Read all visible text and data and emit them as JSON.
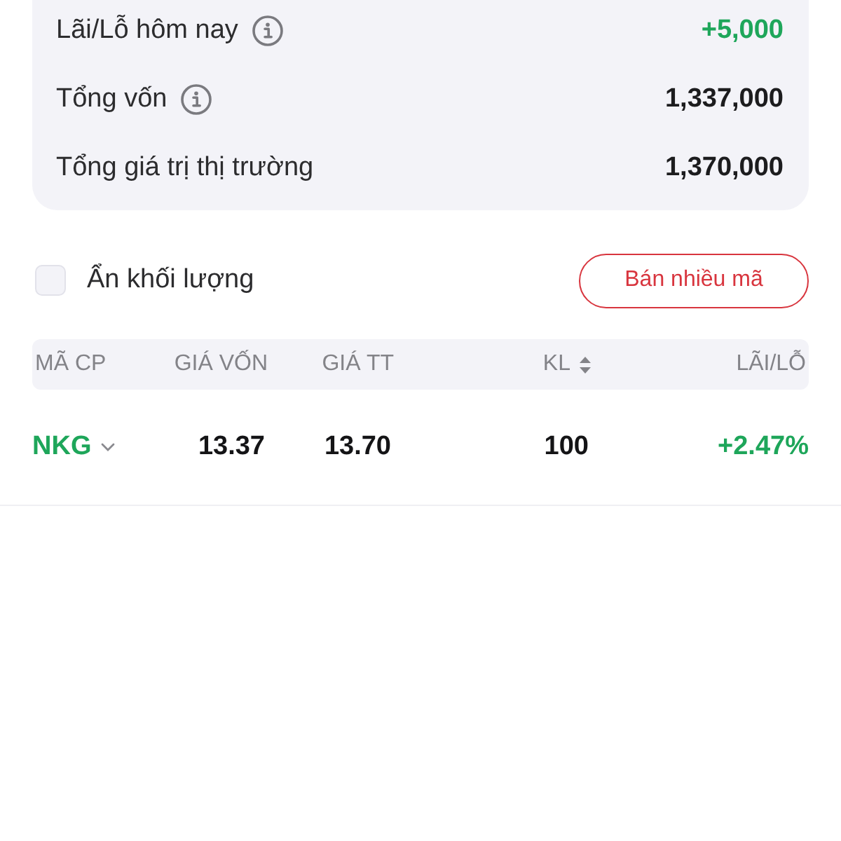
{
  "summary": [
    {
      "label": "Lãi/Lỗ hôm nay",
      "info": true,
      "value": "+5,000",
      "color": "#1ea65a"
    },
    {
      "label": "Tổng vốn",
      "info": true,
      "value": "1,337,000",
      "color": "#1c1c1e"
    },
    {
      "label": "Tổng giá trị thị trường",
      "info": false,
      "value": "1,370,000",
      "color": "#1c1c1e"
    }
  ],
  "hide_volume": {
    "label": "Ẩn khối lượng",
    "checked": false
  },
  "sell_button": "Bán nhiều mã",
  "table": {
    "columns": [
      {
        "label": "MÃ CP",
        "sortable": false
      },
      {
        "label": "GIÁ VỐN",
        "sortable": false
      },
      {
        "label": "GIÁ TT",
        "sortable": false
      },
      {
        "label": "KL",
        "sortable": true
      },
      {
        "label": "LÃI/LỖ",
        "sortable": false
      }
    ],
    "rows": [
      {
        "symbol": "NKG",
        "expanded": false,
        "cost_price": "13.37",
        "market_price": "13.70",
        "volume": "100",
        "pnl": "+2.47%",
        "color": "#1ea65a"
      }
    ]
  }
}
